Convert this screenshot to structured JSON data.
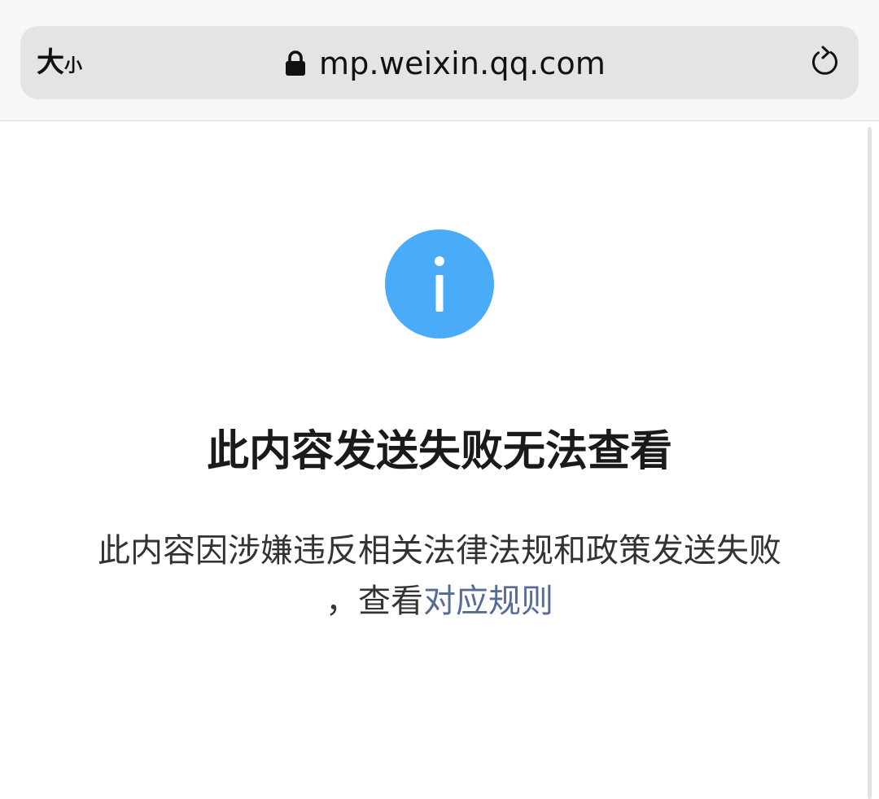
{
  "browser": {
    "text_size_label": "大",
    "text_size_label_small": "小",
    "url": "mp.weixin.qq.com",
    "lock_icon": "lock-icon",
    "reload_icon": "reload-icon"
  },
  "page": {
    "status_icon": "info-icon",
    "status_icon_color": "#4aabf9",
    "title": "此内容发送失败无法查看",
    "message_line1": "此内容因涉嫌违反相关法律法规和政策发送失败",
    "message_line2_prefix": "，查看",
    "rules_link": "对应规则",
    "link_color": "#576b95"
  }
}
